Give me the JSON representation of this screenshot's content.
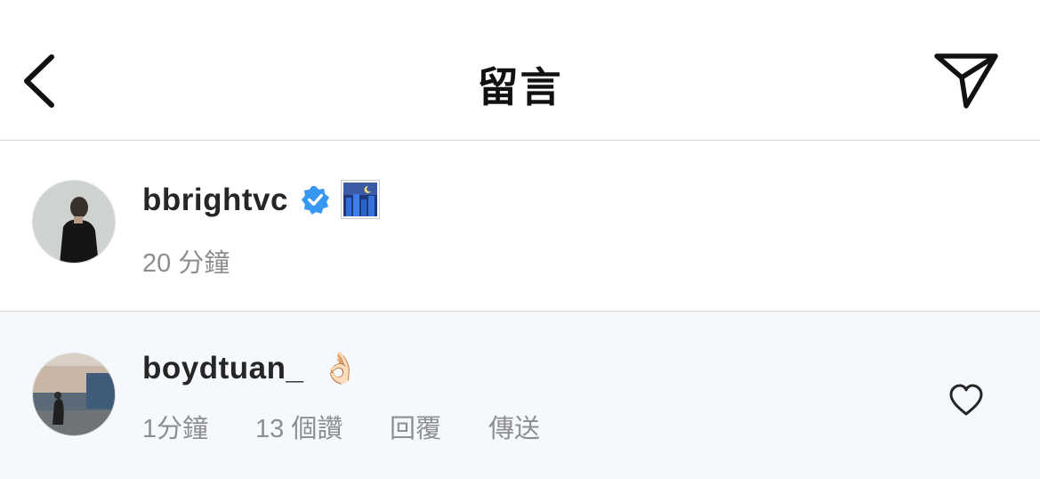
{
  "header": {
    "title": "留言",
    "back_icon": "chevron-left-icon",
    "send_icon": "paper-plane-icon"
  },
  "post": {
    "username": "bbrightvc",
    "verified_icon": "verified-badge-icon",
    "emoji_icon": "night-city-emoji-icon",
    "time": "20 分鐘",
    "accent_color": "#3897f0"
  },
  "comment": {
    "username": "boydtuan_",
    "emoji": "👌🏻",
    "time": "1分鐘",
    "likes": "13 個讚",
    "reply": "回覆",
    "send": "傳送",
    "like_icon": "heart-icon",
    "background_color": "#f5f9fd"
  }
}
